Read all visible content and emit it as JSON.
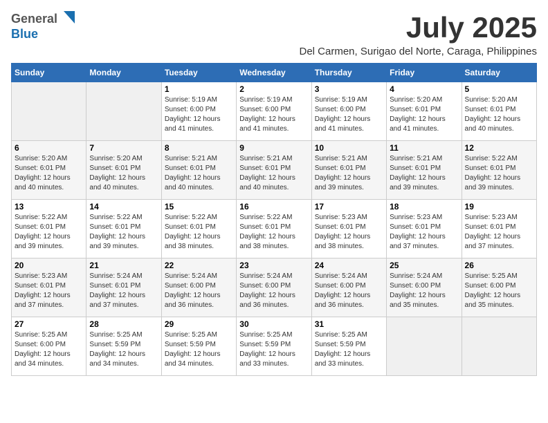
{
  "logo": {
    "general": "General",
    "blue": "Blue"
  },
  "title": {
    "month_year": "July 2025",
    "location": "Del Carmen, Surigao del Norte, Caraga, Philippines"
  },
  "headers": [
    "Sunday",
    "Monday",
    "Tuesday",
    "Wednesday",
    "Thursday",
    "Friday",
    "Saturday"
  ],
  "weeks": [
    [
      {
        "day": "",
        "info": ""
      },
      {
        "day": "",
        "info": ""
      },
      {
        "day": "1",
        "info": "Sunrise: 5:19 AM\nSunset: 6:00 PM\nDaylight: 12 hours and 41 minutes."
      },
      {
        "day": "2",
        "info": "Sunrise: 5:19 AM\nSunset: 6:00 PM\nDaylight: 12 hours and 41 minutes."
      },
      {
        "day": "3",
        "info": "Sunrise: 5:19 AM\nSunset: 6:00 PM\nDaylight: 12 hours and 41 minutes."
      },
      {
        "day": "4",
        "info": "Sunrise: 5:20 AM\nSunset: 6:01 PM\nDaylight: 12 hours and 41 minutes."
      },
      {
        "day": "5",
        "info": "Sunrise: 5:20 AM\nSunset: 6:01 PM\nDaylight: 12 hours and 40 minutes."
      }
    ],
    [
      {
        "day": "6",
        "info": "Sunrise: 5:20 AM\nSunset: 6:01 PM\nDaylight: 12 hours and 40 minutes."
      },
      {
        "day": "7",
        "info": "Sunrise: 5:20 AM\nSunset: 6:01 PM\nDaylight: 12 hours and 40 minutes."
      },
      {
        "day": "8",
        "info": "Sunrise: 5:21 AM\nSunset: 6:01 PM\nDaylight: 12 hours and 40 minutes."
      },
      {
        "day": "9",
        "info": "Sunrise: 5:21 AM\nSunset: 6:01 PM\nDaylight: 12 hours and 40 minutes."
      },
      {
        "day": "10",
        "info": "Sunrise: 5:21 AM\nSunset: 6:01 PM\nDaylight: 12 hours and 39 minutes."
      },
      {
        "day": "11",
        "info": "Sunrise: 5:21 AM\nSunset: 6:01 PM\nDaylight: 12 hours and 39 minutes."
      },
      {
        "day": "12",
        "info": "Sunrise: 5:22 AM\nSunset: 6:01 PM\nDaylight: 12 hours and 39 minutes."
      }
    ],
    [
      {
        "day": "13",
        "info": "Sunrise: 5:22 AM\nSunset: 6:01 PM\nDaylight: 12 hours and 39 minutes."
      },
      {
        "day": "14",
        "info": "Sunrise: 5:22 AM\nSunset: 6:01 PM\nDaylight: 12 hours and 39 minutes."
      },
      {
        "day": "15",
        "info": "Sunrise: 5:22 AM\nSunset: 6:01 PM\nDaylight: 12 hours and 38 minutes."
      },
      {
        "day": "16",
        "info": "Sunrise: 5:22 AM\nSunset: 6:01 PM\nDaylight: 12 hours and 38 minutes."
      },
      {
        "day": "17",
        "info": "Sunrise: 5:23 AM\nSunset: 6:01 PM\nDaylight: 12 hours and 38 minutes."
      },
      {
        "day": "18",
        "info": "Sunrise: 5:23 AM\nSunset: 6:01 PM\nDaylight: 12 hours and 37 minutes."
      },
      {
        "day": "19",
        "info": "Sunrise: 5:23 AM\nSunset: 6:01 PM\nDaylight: 12 hours and 37 minutes."
      }
    ],
    [
      {
        "day": "20",
        "info": "Sunrise: 5:23 AM\nSunset: 6:01 PM\nDaylight: 12 hours and 37 minutes."
      },
      {
        "day": "21",
        "info": "Sunrise: 5:24 AM\nSunset: 6:01 PM\nDaylight: 12 hours and 37 minutes."
      },
      {
        "day": "22",
        "info": "Sunrise: 5:24 AM\nSunset: 6:00 PM\nDaylight: 12 hours and 36 minutes."
      },
      {
        "day": "23",
        "info": "Sunrise: 5:24 AM\nSunset: 6:00 PM\nDaylight: 12 hours and 36 minutes."
      },
      {
        "day": "24",
        "info": "Sunrise: 5:24 AM\nSunset: 6:00 PM\nDaylight: 12 hours and 36 minutes."
      },
      {
        "day": "25",
        "info": "Sunrise: 5:24 AM\nSunset: 6:00 PM\nDaylight: 12 hours and 35 minutes."
      },
      {
        "day": "26",
        "info": "Sunrise: 5:25 AM\nSunset: 6:00 PM\nDaylight: 12 hours and 35 minutes."
      }
    ],
    [
      {
        "day": "27",
        "info": "Sunrise: 5:25 AM\nSunset: 6:00 PM\nDaylight: 12 hours and 34 minutes."
      },
      {
        "day": "28",
        "info": "Sunrise: 5:25 AM\nSunset: 5:59 PM\nDaylight: 12 hours and 34 minutes."
      },
      {
        "day": "29",
        "info": "Sunrise: 5:25 AM\nSunset: 5:59 PM\nDaylight: 12 hours and 34 minutes."
      },
      {
        "day": "30",
        "info": "Sunrise: 5:25 AM\nSunset: 5:59 PM\nDaylight: 12 hours and 33 minutes."
      },
      {
        "day": "31",
        "info": "Sunrise: 5:25 AM\nSunset: 5:59 PM\nDaylight: 12 hours and 33 minutes."
      },
      {
        "day": "",
        "info": ""
      },
      {
        "day": "",
        "info": ""
      }
    ]
  ]
}
